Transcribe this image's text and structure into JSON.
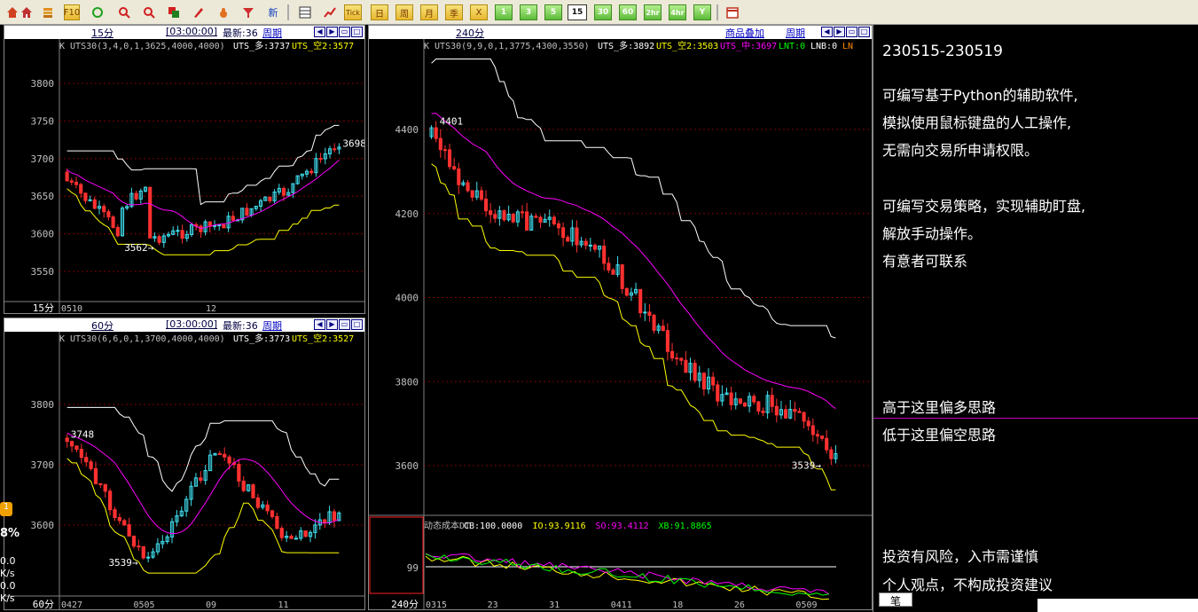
{
  "toolbar": {
    "icons": [
      "home-icon",
      "stack-icon",
      "f10-icon",
      "refresh-icon",
      "zoom-in-icon",
      "zoom-out-icon",
      "window-icon",
      "pen-icon",
      "gourd-icon",
      "filter-icon"
    ],
    "new_label": "新",
    "chart_icons": [
      "table-icon",
      "chart-icon"
    ],
    "tick_label": "Tick",
    "period_labels": [
      "日",
      "周",
      "月",
      "季",
      "X"
    ],
    "minute_labels": [
      "1",
      "3",
      "5",
      "15",
      "30",
      "60",
      "2hr",
      "4hr",
      "Y"
    ],
    "selected_minute": "15",
    "last_icon": "calendar-icon"
  },
  "panel_15m": {
    "title": "15分",
    "time": "[03:00:00]",
    "latest": "最新:36",
    "period_link": "周期",
    "indicator": "K  UTS30(3,4,0,1,3625,4000,4000)",
    "duo": "UTS_多:3737",
    "kong": "UTS_空2:3577",
    "y_ticks": [
      "3800",
      "3750",
      "3700",
      "3650",
      "3600",
      "3550"
    ],
    "annot_high": "3698",
    "annot_low": "3562",
    "bottom_label": "15分",
    "x_labels": [
      "0510",
      "12"
    ]
  },
  "panel_60m": {
    "title": "60分",
    "time": "[03:00:00]",
    "latest": "最新:36",
    "period_link": "周期",
    "indicator": "K  UTS30(6,6,0,1,3700,4000,4000)",
    "duo": "UTS_多:3773",
    "kong": "UTS_空2:3527",
    "y_ticks": [
      "3800",
      "3700",
      "3600"
    ],
    "annot_high": "3748",
    "annot_low": "3539",
    "bottom_label": "60分",
    "x_labels": [
      "0427",
      "0505",
      "09",
      "11"
    ]
  },
  "panel_240m": {
    "title": "240分",
    "overlay_link": "商品叠加",
    "period_link": "周期",
    "indicator": "K  UTS30(9,9,0,1,3775,4300,3550)",
    "duo": "UTS_多:3892",
    "kong": "UTS_空2:3503",
    "zhong": "UTS_中:3697",
    "lnt": "LNT:0",
    "lnb": "LNB:0",
    "lnx": "LN",
    "y_ticks": [
      "4400",
      "4200",
      "4000",
      "3800",
      "3600"
    ],
    "annot_high": "4401",
    "annot_low": "3539",
    "sub_indicator": "动态成本DT",
    "cb": "CB:100.0000",
    "io": "IO:93.9116",
    "so": "SO:93.4112",
    "xb": "XB:91.8865",
    "sub_tick": "99",
    "bottom_label": "240分",
    "x_labels": [
      "0315",
      "23",
      "31",
      "0411",
      "18",
      "26",
      "0509"
    ]
  },
  "notes": {
    "date_range": "230515-230519",
    "lines_a": [
      "可编写基于Python的辅助软件,",
      "模拟使用鼠标键盘的人工操作,",
      "无需向交易所申请权限。"
    ],
    "lines_b": [
      "可编写交易策略，实现辅助盯盘,",
      "解放手动操作。",
      "有意者可联系"
    ],
    "above": "高于这里偏多思路",
    "below": "低于这里偏空思路",
    "risk": "投资有风险，入市需谨慎",
    "opinion": "个人观点，不构成投资建议"
  },
  "side": {
    "badge": "1",
    "pct": "8%",
    "v1": "0.0",
    "u1": "K/s",
    "v2": "0.0",
    "u2": "K/s"
  },
  "tab_label": "笔",
  "colors": {
    "up": "#40e0f0",
    "down": "#ff3030",
    "duo_line": "#ffffff",
    "kong_line": "#ffff00",
    "zhong_line": "#ff00ff",
    "grid": "#800000"
  }
}
